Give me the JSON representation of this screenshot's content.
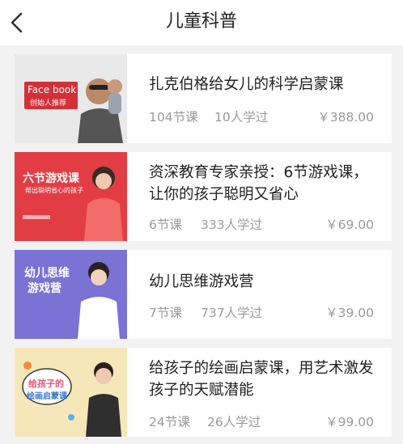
{
  "header": {
    "title": "儿童科普",
    "back_icon": "chevron-left-icon"
  },
  "courses": [
    {
      "title": "扎克伯格给女儿的科学启蒙课",
      "lessons": "104节课",
      "learners": "10人学过",
      "price": "￥388.00",
      "thumb": {
        "line1": "Face book",
        "line2": "创始人推荐",
        "bg": "#dcdcdc",
        "accent": "#d3303a"
      }
    },
    {
      "title": "资深教育专家亲授：6节游戏课，让你的孩子聪明又省心",
      "lessons": "6节课",
      "learners": "333人学过",
      "price": "￥69.00",
      "thumb": {
        "line1": "六节游戏课",
        "line2": "帮出聪明省心的孩子",
        "bg": "#e23d45",
        "accent": "#ffffff"
      }
    },
    {
      "title": "幼儿思维游戏营",
      "lessons": "7节课",
      "learners": "737人学过",
      "price": "￥39.00",
      "thumb": {
        "line1": "幼儿思维",
        "line2": "游戏营",
        "bg": "#7b72d6",
        "accent": "#ffffff"
      }
    },
    {
      "title": "给孩子的绘画启蒙课，用艺术激发孩子的天赋潜能",
      "lessons": "24节课",
      "learners": "26人学过",
      "price": "￥99.00",
      "thumb": {
        "line1": "给孩子的",
        "line2": "绘画启蒙课",
        "bg": "#f6e7b8",
        "accent": "#e0567c"
      }
    }
  ]
}
